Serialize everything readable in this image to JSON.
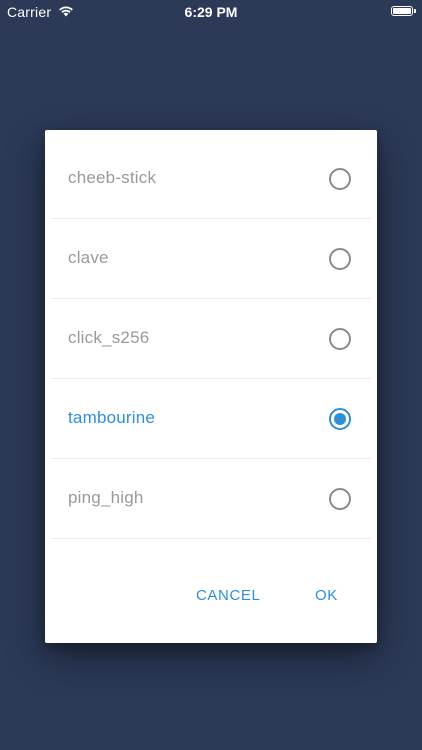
{
  "status_bar": {
    "carrier": "Carrier",
    "time": "6:29 PM",
    "battery_level": 1.0
  },
  "dialog": {
    "options": [
      {
        "label": "cheeb-stick",
        "selected": false
      },
      {
        "label": "clave",
        "selected": false
      },
      {
        "label": "click_s256",
        "selected": false
      },
      {
        "label": "tambourine",
        "selected": true
      },
      {
        "label": "ping_high",
        "selected": false
      }
    ],
    "cancel_label": "CANCEL",
    "ok_label": "OK"
  },
  "colors": {
    "background": "#2c3a58",
    "accent": "#2e8fd6",
    "unselected_text": "#999999"
  }
}
